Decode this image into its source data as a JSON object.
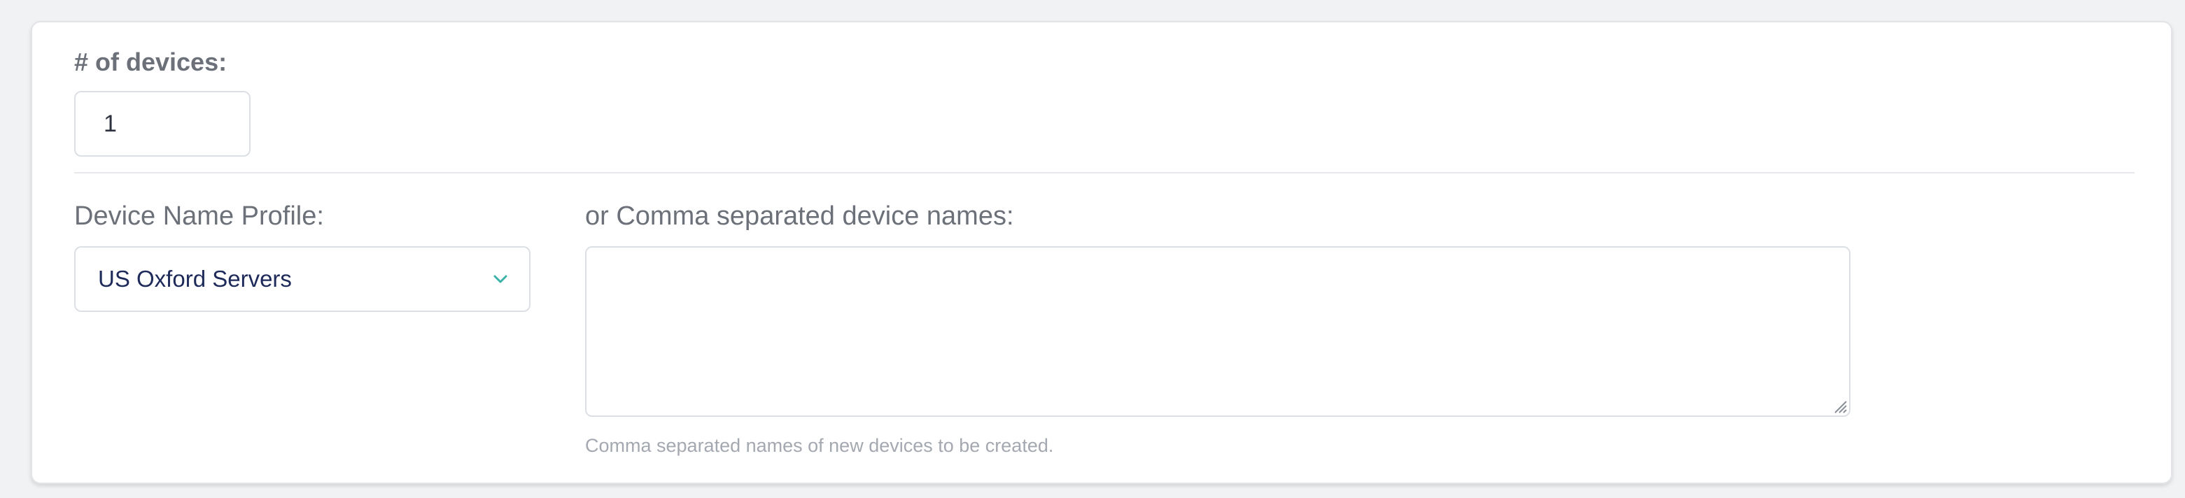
{
  "device_count": {
    "label": "# of devices:",
    "value": "1"
  },
  "device_name_profile": {
    "label": "Device Name Profile:",
    "selected": "US Oxford Servers",
    "icon": "chevron-down-icon",
    "accent_color": "#3bb3a8"
  },
  "device_names": {
    "label": "or Comma separated device names:",
    "value": "",
    "help": "Comma separated names of new devices to be created."
  }
}
